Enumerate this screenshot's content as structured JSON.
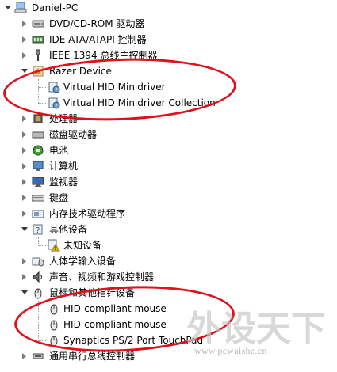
{
  "tree": {
    "root": {
      "label": "Daniel-PC",
      "icon": "computer-icon"
    },
    "items": [
      {
        "id": "dvd",
        "label": "DVD/CD-ROM 驱动器",
        "icon": "dvd-drive-icon"
      },
      {
        "id": "ide",
        "label": "IDE ATA/ATAPI 控制器",
        "icon": "ide-controller-icon"
      },
      {
        "id": "ieee",
        "label": "IEEE 1394 总线主控制器",
        "icon": "ieee1394-icon"
      },
      {
        "id": "razer",
        "label": "Razer Device",
        "icon": "razer-device-icon",
        "children": [
          {
            "label": "Virtual HID Minidriver",
            "icon": "hid-device-icon"
          },
          {
            "label": "Virtual HID Minidriver Collection",
            "icon": "hid-device-icon"
          }
        ]
      },
      {
        "id": "cpu",
        "label": "处理器",
        "icon": "processor-icon"
      },
      {
        "id": "disk",
        "label": "磁盘驱动器",
        "icon": "disk-drive-icon"
      },
      {
        "id": "battery",
        "label": "电池",
        "icon": "battery-icon"
      },
      {
        "id": "computer",
        "label": "计算机",
        "icon": "computer-icon"
      },
      {
        "id": "monitor",
        "label": "监视器",
        "icon": "monitor-icon"
      },
      {
        "id": "keyboard",
        "label": "键盘",
        "icon": "keyboard-icon"
      },
      {
        "id": "memtech",
        "label": "内存技术驱动程序",
        "icon": "memory-technology-icon"
      },
      {
        "id": "other",
        "label": "其他设备",
        "icon": "other-devices-icon",
        "children": [
          {
            "label": "未知设备",
            "icon": "unknown-device-warning-icon"
          }
        ]
      },
      {
        "id": "hid",
        "label": "人体学输入设备",
        "icon": "hid-input-icon"
      },
      {
        "id": "sound",
        "label": "声音、视频和游戏控制器",
        "icon": "sound-icon"
      },
      {
        "id": "mice",
        "label": "鼠标和其他指针设备",
        "icon": "mouse-icon",
        "children": [
          {
            "label": "HID-compliant mouse",
            "icon": "mouse-icon"
          },
          {
            "label": "HID-compliant mouse",
            "icon": "mouse-icon"
          },
          {
            "label": "Synaptics PS/2 Port TouchPad",
            "icon": "mouse-icon"
          }
        ]
      },
      {
        "id": "usb",
        "label": "通用串行总线控制器",
        "icon": "usb-controller-icon"
      }
    ]
  },
  "colors": {
    "highlight_circle": "#e0101c",
    "watermark": "#c8c8c8"
  },
  "watermark": {
    "logo_text": "外设天下",
    "url": "www.pcwaishe.cn"
  }
}
